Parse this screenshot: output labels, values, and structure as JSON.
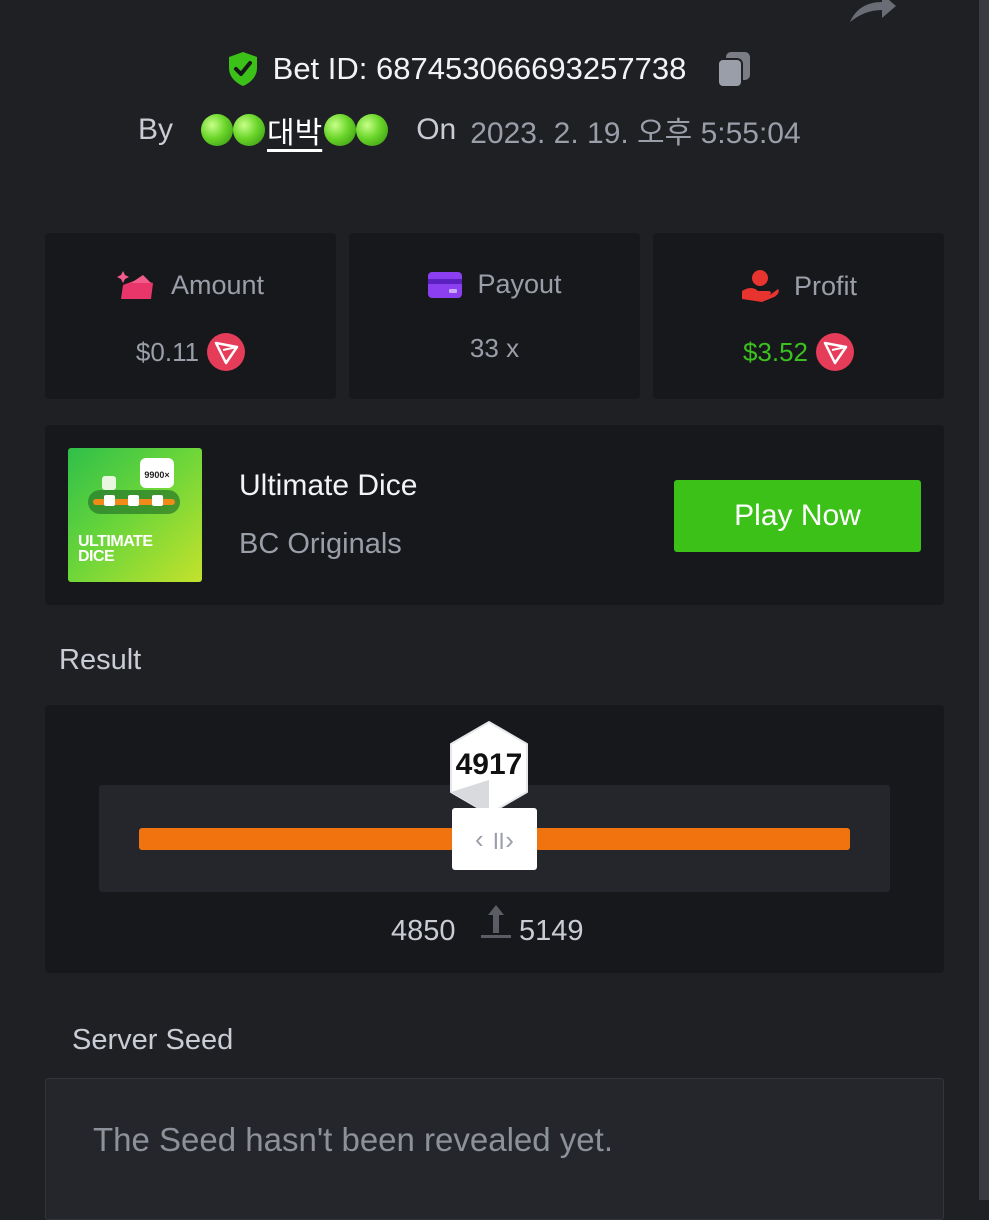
{
  "header": {
    "bet_id_label": "Bet ID: 687453066693257738",
    "by_label": "By",
    "username_text": "대박",
    "on_label": "On",
    "date": "2023. 2. 19. 오후 5:55:04"
  },
  "stats": {
    "amount": {
      "label": "Amount",
      "value": "$0.11"
    },
    "payout": {
      "label": "Payout",
      "value": "33 x"
    },
    "profit": {
      "label": "Profit",
      "value": "$3.52"
    }
  },
  "game": {
    "thumb_badge": "9900×",
    "thumb_title_1": "ULTIMATE",
    "thumb_title_2": "DICE",
    "name": "Ultimate Dice",
    "provider": "BC Originals",
    "play_label": "Play Now"
  },
  "result": {
    "label": "Result",
    "value": "4917",
    "range_low": "4850",
    "range_high": "5149"
  },
  "server_seed": {
    "label": "Server Seed",
    "text": "The Seed hasn't been revealed yet."
  },
  "colors": {
    "background": "#1f2024",
    "card": "#17181b",
    "accent_green": "#3bc117",
    "profit_green": "#3cc01f",
    "slider_orange": "#f0730f",
    "trx_red": "#e53c59"
  },
  "icons": {
    "verified": "shield-check-icon",
    "copy": "copy-icon",
    "share": "share-icon",
    "amount": "wallet-sparkle-icon",
    "payout": "card-icon",
    "profit": "hand-coin-icon",
    "currency": "tron-icon"
  }
}
